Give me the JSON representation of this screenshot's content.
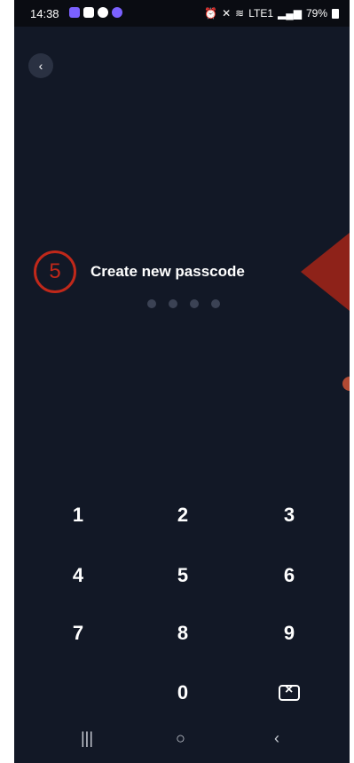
{
  "status": {
    "time": "14:38",
    "network": "LTE1",
    "battery": "79%"
  },
  "nav": {
    "back": "‹"
  },
  "callout": {
    "number": "5"
  },
  "title": "Create new passcode",
  "keys": {
    "k1": "1",
    "k2": "2",
    "k3": "3",
    "k4": "4",
    "k5": "5",
    "k6": "6",
    "k7": "7",
    "k8": "8",
    "k9": "9",
    "k0": "0"
  },
  "system_nav": {
    "recents": "|||",
    "home": "○",
    "back": "‹"
  },
  "colors": {
    "background": "#121826",
    "accent_callout": "#c0281a",
    "dot_inactive": "#3b4254"
  }
}
